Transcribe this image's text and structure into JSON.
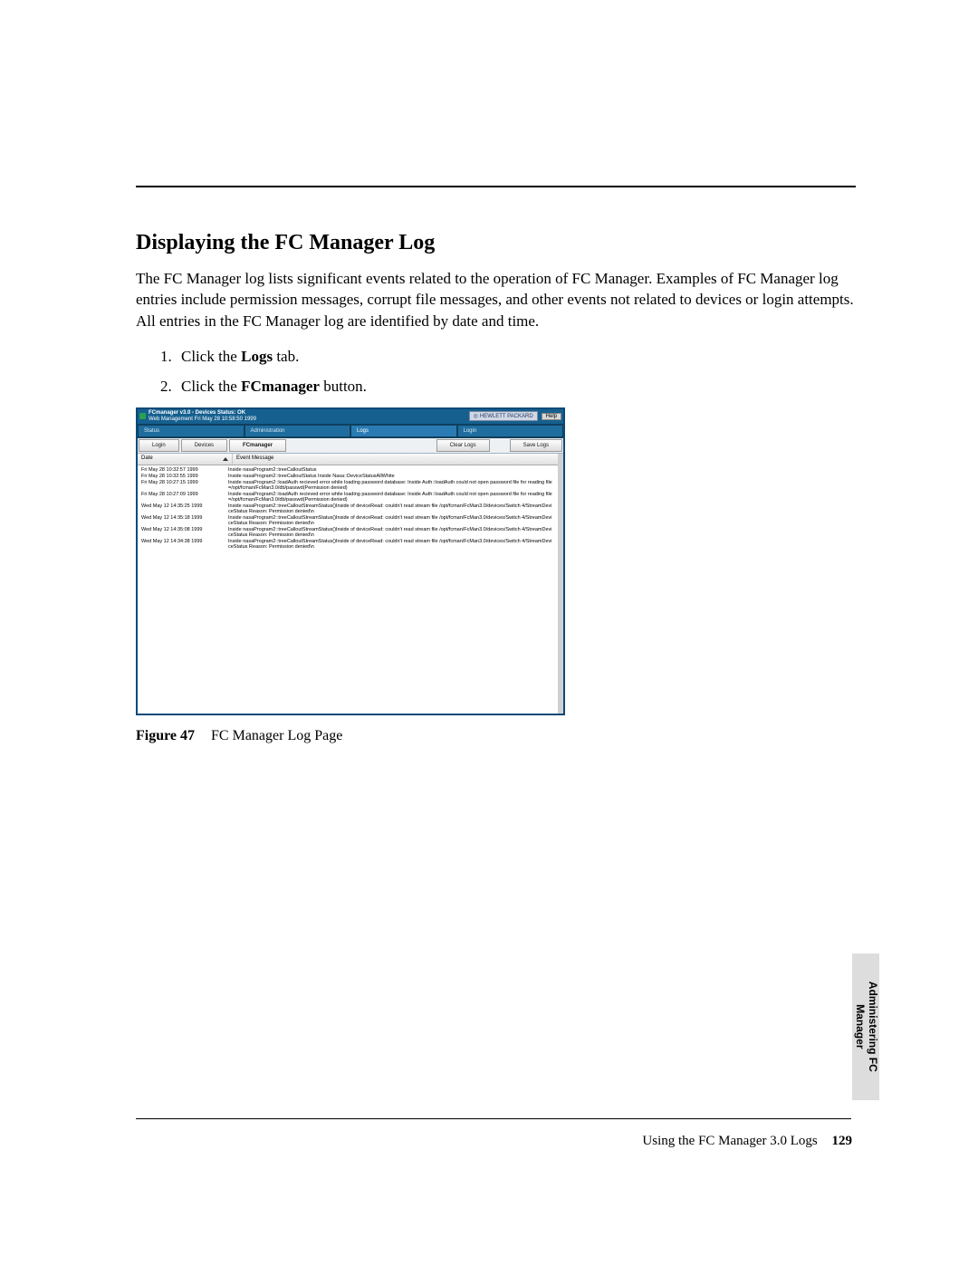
{
  "section": {
    "title": "Displaying the FC Manager Log",
    "para1": "The FC Manager log lists significant events related to the operation of FC Manager. Examples of FC Manager log entries include permission messages, corrupt file messages, and other events not related to devices or login attempts. All entries in the FC Manager log are identified by date and time.",
    "steps": {
      "s1a": "Click the ",
      "s1b": "Logs",
      "s1c": " tab.",
      "s2a": "Click the ",
      "s2b": "FCmanager",
      "s2c": " button."
    },
    "figure_label": "Figure 47",
    "figure_caption": "FC Manager Log Page"
  },
  "screenshot": {
    "title_line1": "FCmanager v3.0 - Devices Status: OK",
    "title_line2": "Web Management Fri May 28 10:58:50 1999",
    "hp_badge": "HEWLETT PACKARD",
    "help_label": "Help",
    "tabs": [
      "Status",
      "Administration",
      "Logs",
      "Login"
    ],
    "active_tab_index": 2,
    "sub_buttons": [
      "Login",
      "Devices",
      "FCmanager",
      "Clear Logs",
      "Save Logs"
    ],
    "active_sub_index": 2,
    "columns": {
      "date": "Date",
      "message": "Event Message"
    },
    "rows": [
      {
        "date": "Fri May 28 10:32:57 1999",
        "msg": "Inside nasaProgram2::treeCalloutStatus"
      },
      {
        "date": "Fri May 28 10:32:55 1999",
        "msg": "Inside nasaProgram2::treeCalloutStatus Inside Nasa::DeviceStatusAllWhite"
      },
      {
        "date": "Fri May 28 10:27:15 1999",
        "msg": "Inside nasaProgram2::loadAuth recieved error while loading password database: Inside Auth::loadAuth could not open password file for reading file=/opt/fcman/FcMan3.0/db/passwd(Permission denied)"
      },
      {
        "date": "Fri May 28 10:27:09 1999",
        "msg": "Inside nasaProgram2::loadAuth recieved error while loading password database: Inside Auth::loadAuth could not open password file for reading file=/opt/fcman/FcMan3.0/db/passwd(Permission denied)"
      },
      {
        "date": "Wed May 12 14:35:25 1999",
        "msg": "Inside nasaProgram2::treeCalloutStreamStatus()Inside of deviceRead: couldn't read stream file /opt/fcman/FcMan3.0/devices/Switch 4/StreamDeviceStatus Reason: Permission denied\\n"
      },
      {
        "date": "Wed May 12 14:35:18 1999",
        "msg": "Inside nasaProgram2::treeCalloutStreamStatus()Inside of deviceRead: couldn't read stream file /opt/fcman/FcMan3.0/devices/Switch 4/StreamDeviceStatus Reason: Permission denied\\n"
      },
      {
        "date": "Wed May 12 14:35:08 1999",
        "msg": "Inside nasaProgram2::treeCalloutStreamStatus()Inside of deviceRead: couldn't read stream file /opt/fcman/FcMan3.0/devices/Switch 4/StreamDeviceStatus Reason: Permission denied\\n"
      },
      {
        "date": "Wed May 12 14:34:38 1999",
        "msg": "Inside nasaProgram2::treeCalloutStreamStatus()Inside of deviceRead: couldn't read stream file /opt/fcman/FcMan3.0/devices/Switch 4/StreamDeviceStatus Reason: Permission denied\\n"
      }
    ]
  },
  "side_tab": {
    "line1": "Administering FC",
    "line2": "Manager"
  },
  "footer": {
    "text": "Using the FC Manager 3.0 Logs",
    "page": "129"
  }
}
